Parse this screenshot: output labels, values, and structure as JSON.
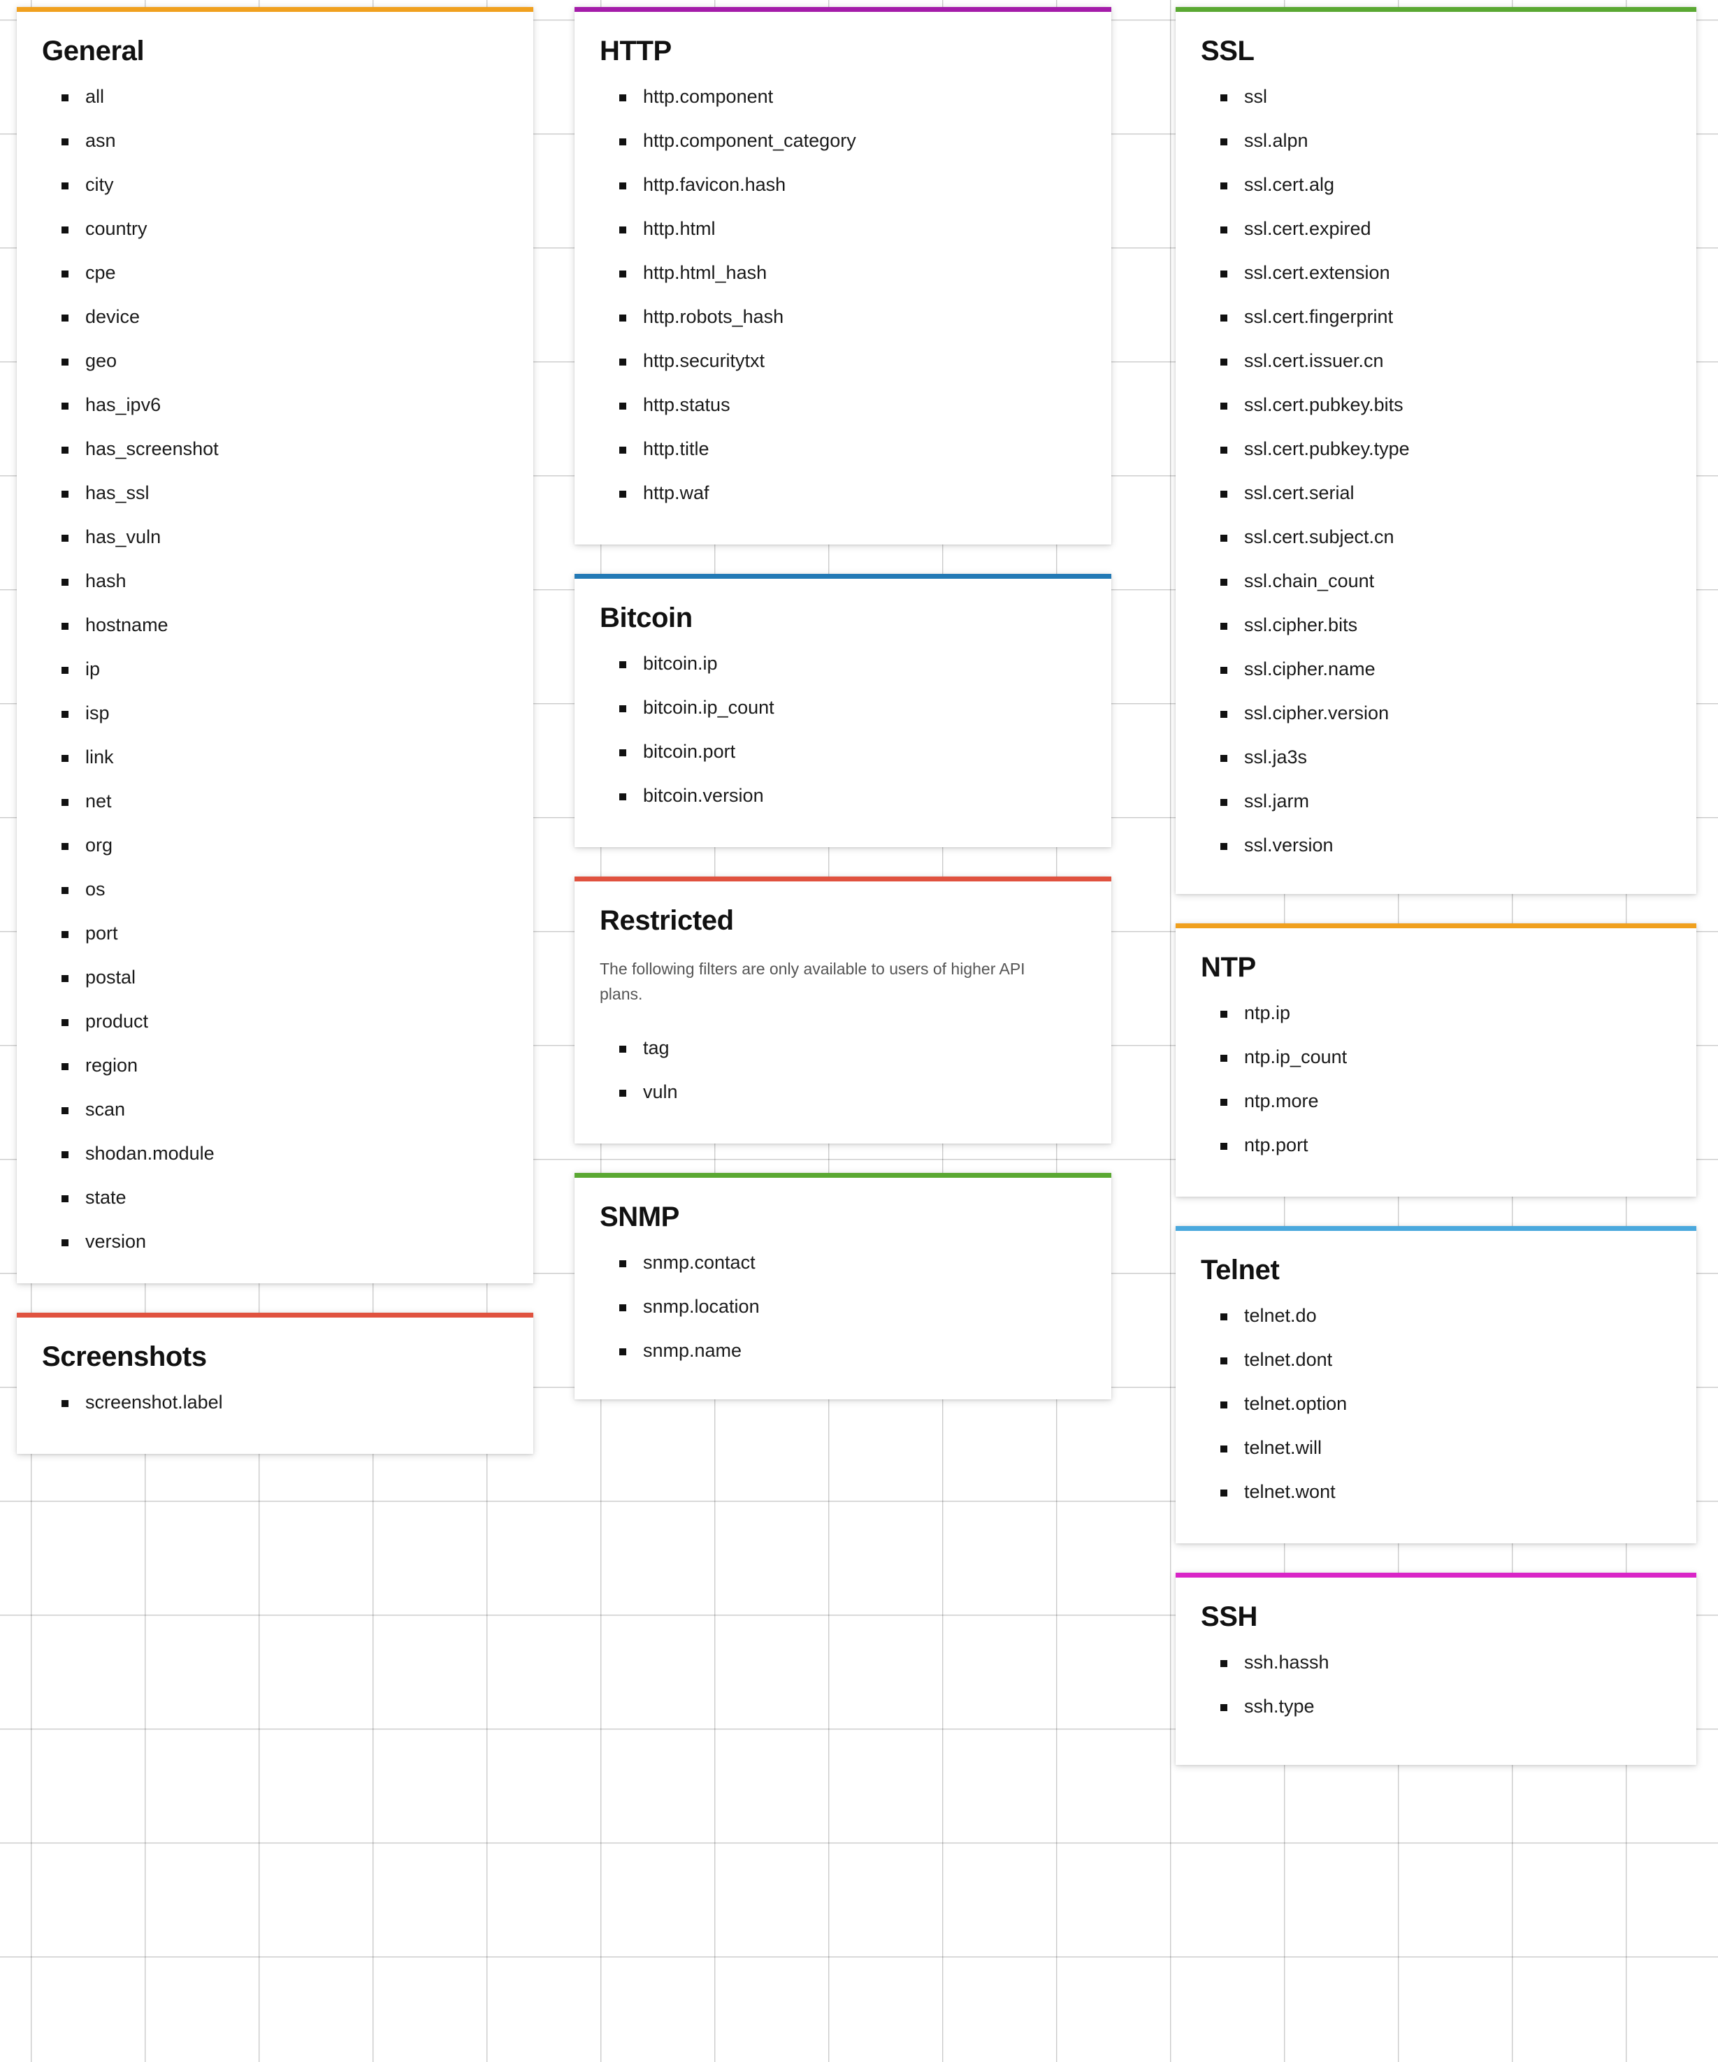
{
  "background": {
    "grid_color": "#ebebeb",
    "tick_color": "#c9c9c9"
  },
  "accents": {
    "orange": "#f0a01e",
    "red": "#e0523f",
    "purple": "#a41ca9",
    "blue": "#2279b5",
    "green": "#5aa832",
    "light_blue": "#4aa8dd",
    "magenta": "#d925c7"
  },
  "columns": [
    {
      "name": "left",
      "cards": [
        {
          "id": "general",
          "title": "General",
          "accent": "#f0a01e",
          "items": [
            "all",
            "asn",
            "city",
            "country",
            "cpe",
            "device",
            "geo",
            "has_ipv6",
            "has_screenshot",
            "has_ssl",
            "has_vuln",
            "hash",
            "hostname",
            "ip",
            "isp",
            "link",
            "net",
            "org",
            "os",
            "port",
            "postal",
            "product",
            "region",
            "scan",
            "shodan.module",
            "state",
            "version"
          ]
        },
        {
          "id": "screenshots",
          "title": "Screenshots",
          "accent": "#e0523f",
          "items": [
            "screenshot.label"
          ]
        }
      ]
    },
    {
      "name": "middle",
      "cards": [
        {
          "id": "http",
          "title": "HTTP",
          "accent": "#a41ca9",
          "items": [
            "http.component",
            "http.component_category",
            "http.favicon.hash",
            "http.html",
            "http.html_hash",
            "http.robots_hash",
            "http.securitytxt",
            "http.status",
            "http.title",
            "http.waf"
          ]
        },
        {
          "id": "bitcoin",
          "title": "Bitcoin",
          "accent": "#2279b5",
          "items": [
            "bitcoin.ip",
            "bitcoin.ip_count",
            "bitcoin.port",
            "bitcoin.version"
          ]
        },
        {
          "id": "restricted",
          "title": "Restricted",
          "accent": "#e0523f",
          "description": "The following filters are only available to users of higher API plans.",
          "items": [
            "tag",
            "vuln"
          ]
        },
        {
          "id": "snmp",
          "title": "SNMP",
          "accent": "#5aa832",
          "items": [
            "snmp.contact",
            "snmp.location",
            "snmp.name"
          ]
        }
      ]
    },
    {
      "name": "right",
      "cards": [
        {
          "id": "ssl",
          "title": "SSL",
          "accent": "#5aa832",
          "items": [
            "ssl",
            "ssl.alpn",
            "ssl.cert.alg",
            "ssl.cert.expired",
            "ssl.cert.extension",
            "ssl.cert.fingerprint",
            "ssl.cert.issuer.cn",
            "ssl.cert.pubkey.bits",
            "ssl.cert.pubkey.type",
            "ssl.cert.serial",
            "ssl.cert.subject.cn",
            "ssl.chain_count",
            "ssl.cipher.bits",
            "ssl.cipher.name",
            "ssl.cipher.version",
            "ssl.ja3s",
            "ssl.jarm",
            "ssl.version"
          ]
        },
        {
          "id": "ntp",
          "title": "NTP",
          "accent": "#f0a01e",
          "items": [
            "ntp.ip",
            "ntp.ip_count",
            "ntp.more",
            "ntp.port"
          ]
        },
        {
          "id": "telnet",
          "title": "Telnet",
          "accent": "#4aa8dd",
          "items": [
            "telnet.do",
            "telnet.dont",
            "telnet.option",
            "telnet.will",
            "telnet.wont"
          ]
        },
        {
          "id": "ssh",
          "title": "SSH",
          "accent": "#d925c7",
          "items": [
            "ssh.hassh",
            "ssh.type"
          ]
        }
      ]
    }
  ]
}
